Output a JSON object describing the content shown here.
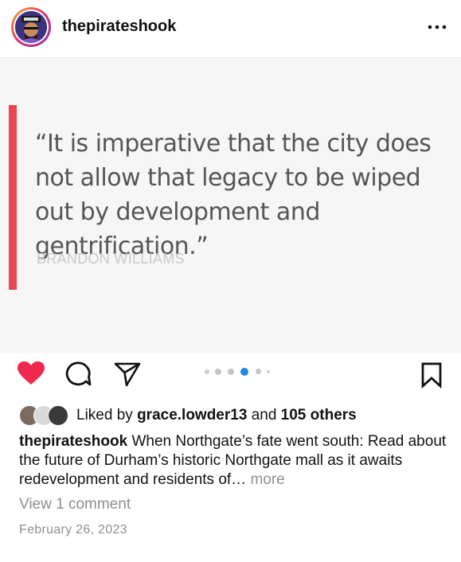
{
  "header": {
    "username": "thepirateshook",
    "avatar_icon": "avatar-icon",
    "more_icon": "more-horizontal-icon"
  },
  "post": {
    "quote": "“It is imperative that the city does not allow that legacy to be wiped out by development and gentrification.”",
    "author": "BRANDON WILLIAMS",
    "accent_color": "#e8474f"
  },
  "actions": {
    "like_icon": "heart-filled-icon",
    "comment_icon": "comment-icon",
    "share_icon": "send-icon",
    "save_icon": "bookmark-icon",
    "carousel": {
      "count": 6,
      "active_index": 3
    },
    "like_color": "#ed2a4d",
    "active_dot_color": "#1e88e5"
  },
  "likes": {
    "prefix": "Liked by",
    "user": "grace.lowder13",
    "middle": "and",
    "others": "105 others"
  },
  "caption": {
    "username": "thepirateshook",
    "text": "When Northgate’s fate went south: Read about the future of Durham’s historic Northgate mall as it awaits redevelopment and residents of…",
    "more": "more"
  },
  "comments": {
    "label": "View 1 comment"
  },
  "date": "February 26, 2023"
}
